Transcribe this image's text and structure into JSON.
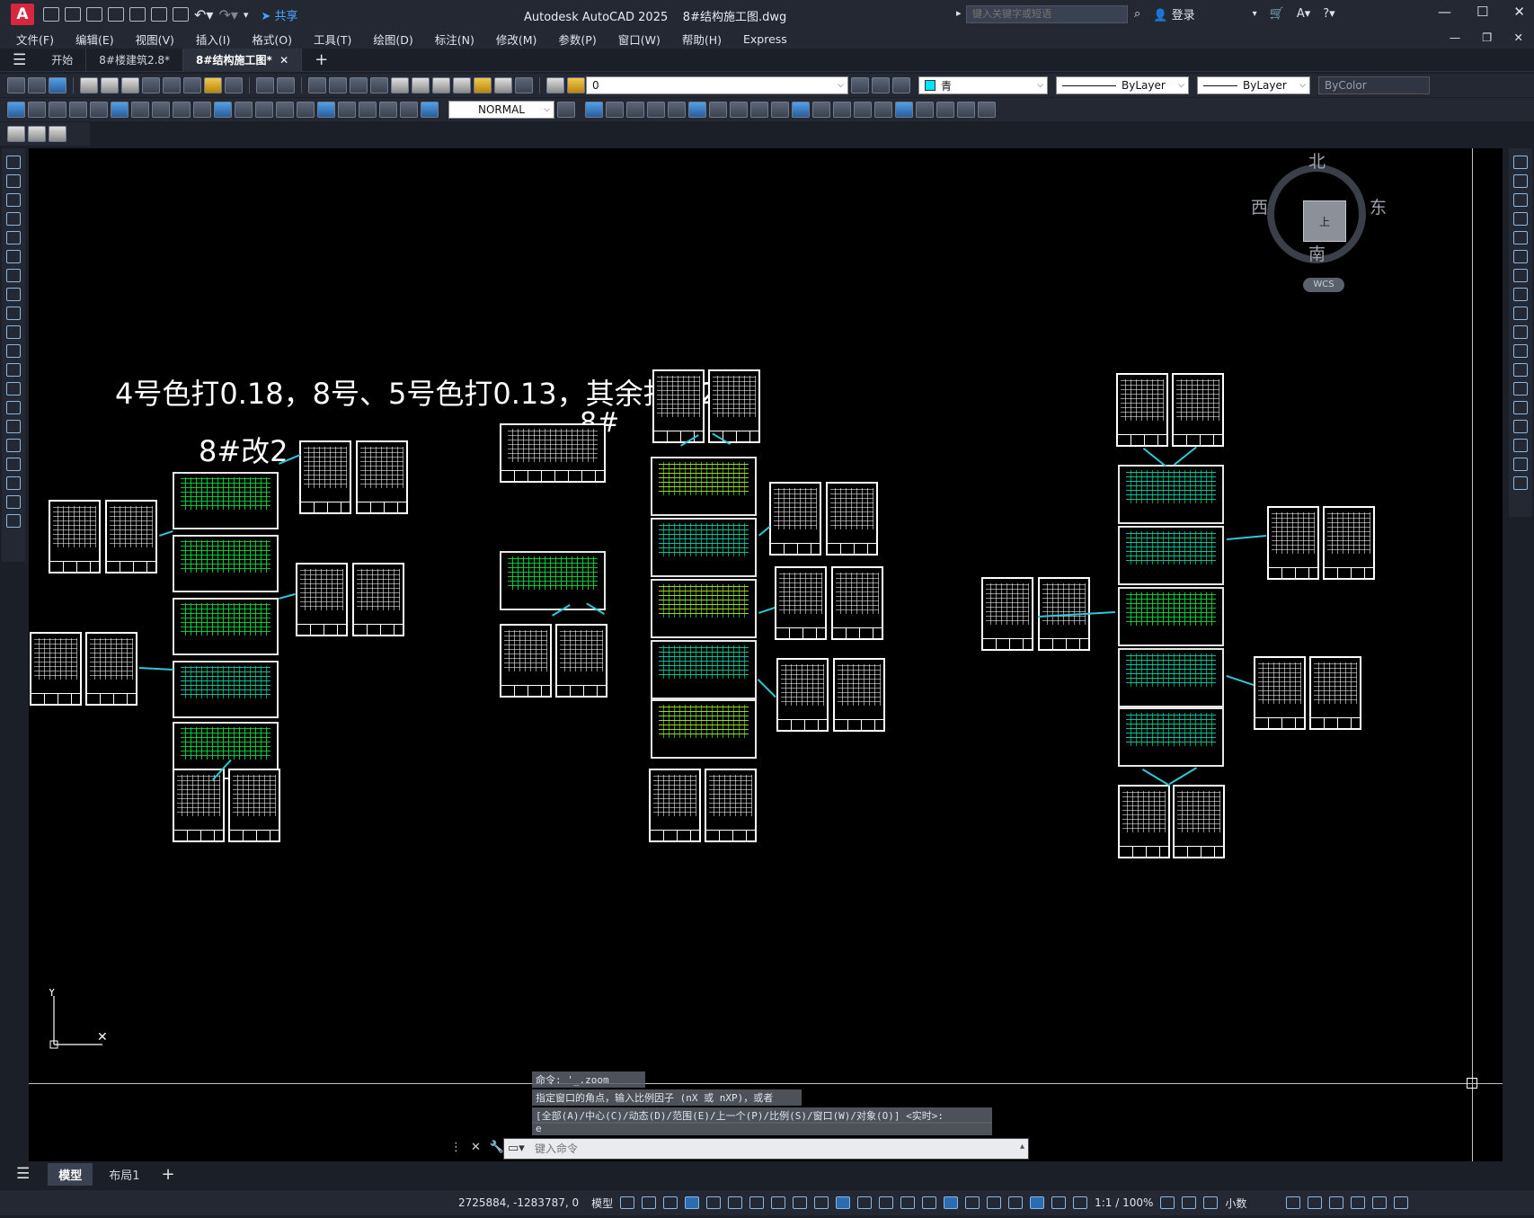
{
  "app": {
    "logo": "A",
    "title": "Autodesk AutoCAD 2025    8#结构施工图.dwg",
    "share_label": "共享",
    "search_placeholder": "键入关键字或短语",
    "login_label": "登录"
  },
  "menu": {
    "items": [
      "文件(F)",
      "编辑(E)",
      "视图(V)",
      "插入(I)",
      "格式(O)",
      "工具(T)",
      "绘图(D)",
      "标注(N)",
      "修改(M)",
      "参数(P)",
      "窗口(W)",
      "帮助(H)",
      "Express"
    ]
  },
  "tabs": [
    {
      "label": "开始"
    },
    {
      "label": "8#楼建筑2.8*"
    },
    {
      "label": "8#结构施工图*"
    }
  ],
  "toolbar": {
    "layer_value": "0",
    "color_value": "青",
    "linetype_value": "ByLayer",
    "lineweight_value": "ByLayer",
    "plotstyle_value": "ByColor",
    "dimstyle_value": "NORMAL",
    "accent_color": "#00e5ff"
  },
  "canvas": {
    "note_text": "4号色打0.18，8号、5号色打0.13，其余打0.21",
    "label_a": "8#改2",
    "label_b": "8#",
    "viewcube": {
      "north": "北",
      "south": "南",
      "east": "东",
      "west": "西",
      "face": "上",
      "wcs": "WCS"
    }
  },
  "command": {
    "history": [
      "命令: '_.zoom",
      "指定窗口的角点，输入比例因子 (nX 或 nXP)，或者",
      "[全部(A)/中心(C)/动态(D)/范围(E)/上一个(P)/比例(S)/窗口(W)/对象(O)] <实时>:",
      "e"
    ],
    "placeholder": "键入命令"
  },
  "layout_tabs": [
    {
      "label": "模型"
    },
    {
      "label": "布局1"
    }
  ],
  "status": {
    "coords": "2725884, -1283787, 0",
    "model_label": "模型",
    "scale": "1:1 / 100%",
    "units": "小数"
  }
}
